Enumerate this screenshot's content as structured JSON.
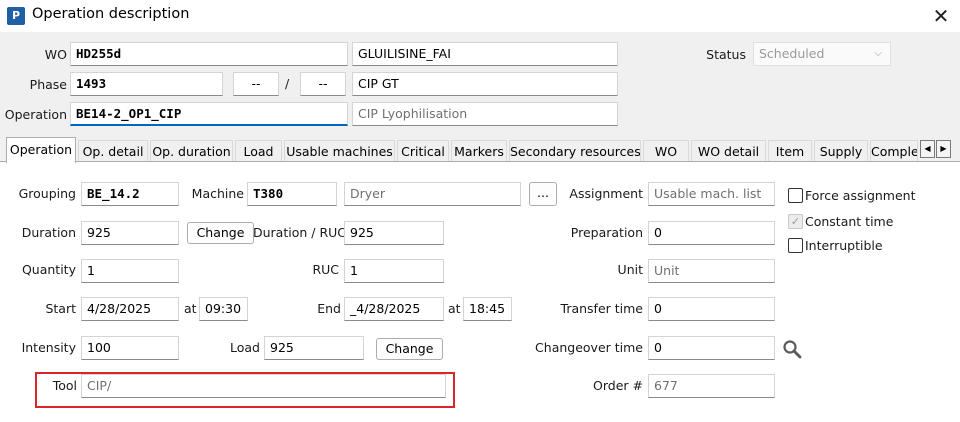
{
  "window": {
    "app_icon_letter": "P",
    "title": "Operation description",
    "close_glyph": "✕"
  },
  "header": {
    "wo_label": "WO",
    "wo_value": "HD255d",
    "wo_desc": "GLUILISINE_FAI",
    "phase_label": "Phase",
    "phase_value": "1493",
    "phase_sub1": "--",
    "phase_sep": "/",
    "phase_sub2": "--",
    "phase_desc": "CIP GT",
    "operation_label": "Operation",
    "operation_value": "BE14-2_OP1_CIP",
    "operation_desc": "CIP Lyophilisation",
    "status_label": "Status",
    "status_value": "Scheduled"
  },
  "tabs": [
    {
      "label": "Operation",
      "active": true
    },
    {
      "label": "Op. detail"
    },
    {
      "label": "Op. duration"
    },
    {
      "label": "Load"
    },
    {
      "label": "Usable machines"
    },
    {
      "label": "Critical"
    },
    {
      "label": "Markers"
    },
    {
      "label": "Secondary resources"
    },
    {
      "label": "WO"
    },
    {
      "label": "WO detail"
    },
    {
      "label": "Item"
    },
    {
      "label": "Supply"
    },
    {
      "label": "Comple"
    }
  ],
  "form": {
    "grouping_label": "Grouping",
    "grouping_value": "BE_14.2",
    "machine_label": "Machine",
    "machine_value": "T380",
    "machine_desc": "Dryer",
    "machine_browse": "...",
    "assignment_label": "Assignment",
    "assignment_value": "Usable mach. list",
    "force_assignment_label": "Force assignment",
    "constant_time_label": "Constant time",
    "interruptible_label": "Interruptible",
    "duration_label": "Duration",
    "duration_value": "925",
    "duration_change": "Change",
    "duration_ruc_label": "Duration / RUC",
    "duration_ruc_value": "925",
    "preparation_label": "Preparation",
    "preparation_value": "0",
    "quantity_label": "Quantity",
    "quantity_value": "1",
    "ruc_label": "RUC",
    "ruc_value": "1",
    "unit_label": "Unit",
    "unit_value": "Unit",
    "start_label": "Start",
    "start_date": "4/28/2025",
    "start_at": "at",
    "start_time": "09:30",
    "end_label": "End",
    "end_date": "_4/28/2025",
    "end_at": "at",
    "end_time": "18:45",
    "transfer_time_label": "Transfer time",
    "transfer_time_value": "0",
    "intensity_label": "Intensity",
    "intensity_value": "100",
    "load_label": "Load",
    "load_value": "925",
    "load_change": "Change",
    "changeover_label": "Changeover time",
    "changeover_value": "0",
    "tool_label": "Tool",
    "tool_value": "CIP/",
    "order_label": "Order #",
    "order_value": "677"
  },
  "icons": {
    "search": "search-icon",
    "chevron": "chevron-down-icon",
    "close": "close-icon"
  },
  "colors": {
    "accent": "#0067c0",
    "highlight": "#d9262b",
    "app_icon": "#1f5fa8"
  }
}
